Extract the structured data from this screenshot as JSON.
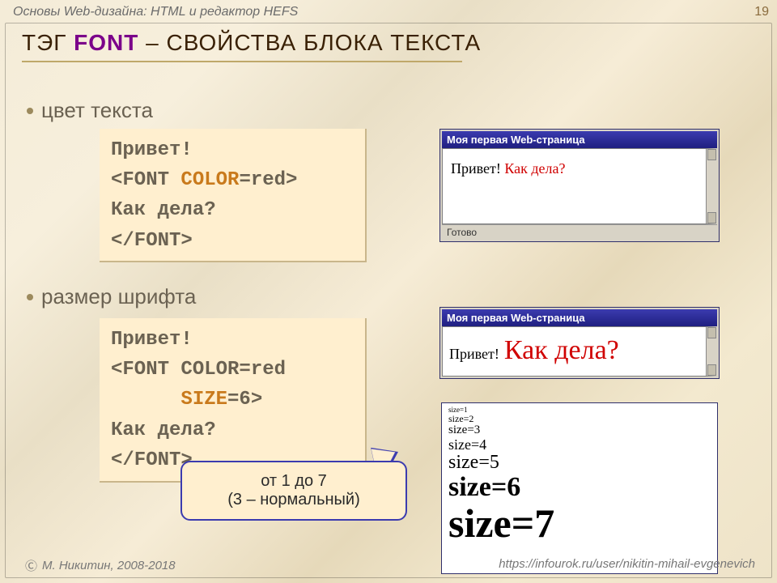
{
  "header": {
    "course": "Основы Web-дизайна: HTML и редактор HEFS",
    "page_number": "19"
  },
  "title": {
    "prefix": "ТЭГ ",
    "keyword": "FONT",
    "suffix": " – СВОЙСТВА БЛОКА ТЕКСТА"
  },
  "bullets": {
    "b1": "цвет текста",
    "b2": "размер шрифта"
  },
  "code1": {
    "l1": "Привет!",
    "l2a": "<FONT ",
    "l2b": "COLOR",
    "l2c": "=red>",
    "l3": "Как дела?",
    "l4": "</FONT>"
  },
  "code2": {
    "l1": "Привет!",
    "l2": "<FONT COLOR=red",
    "l3a": "      ",
    "l3b": "SIZE",
    "l3c": "=6>",
    "l4": "Как дела?",
    "l5": "</FONT>"
  },
  "browser": {
    "title": "Моя первая Web-страница",
    "status": "Готово",
    "preview1_black": "Привет! ",
    "preview1_red": "Как дела?",
    "preview2_black": "Привет!",
    "preview2_red": "Как дела?"
  },
  "sizes": {
    "s1": "size=1",
    "s2": "size=2",
    "s3": "size=3",
    "s4": "size=4",
    "s5": "size=5",
    "s6": "size=6",
    "s7": "size=7"
  },
  "callout": {
    "line1": "от 1 до 7",
    "line2": "(3 – нормальный)"
  },
  "footer": {
    "copyright_symbol": "Ⓒ",
    "author": "М. Никитин, 2008-2018",
    "url": "https://infourok.ru/user/nikitin-mihail-evgenevich"
  }
}
